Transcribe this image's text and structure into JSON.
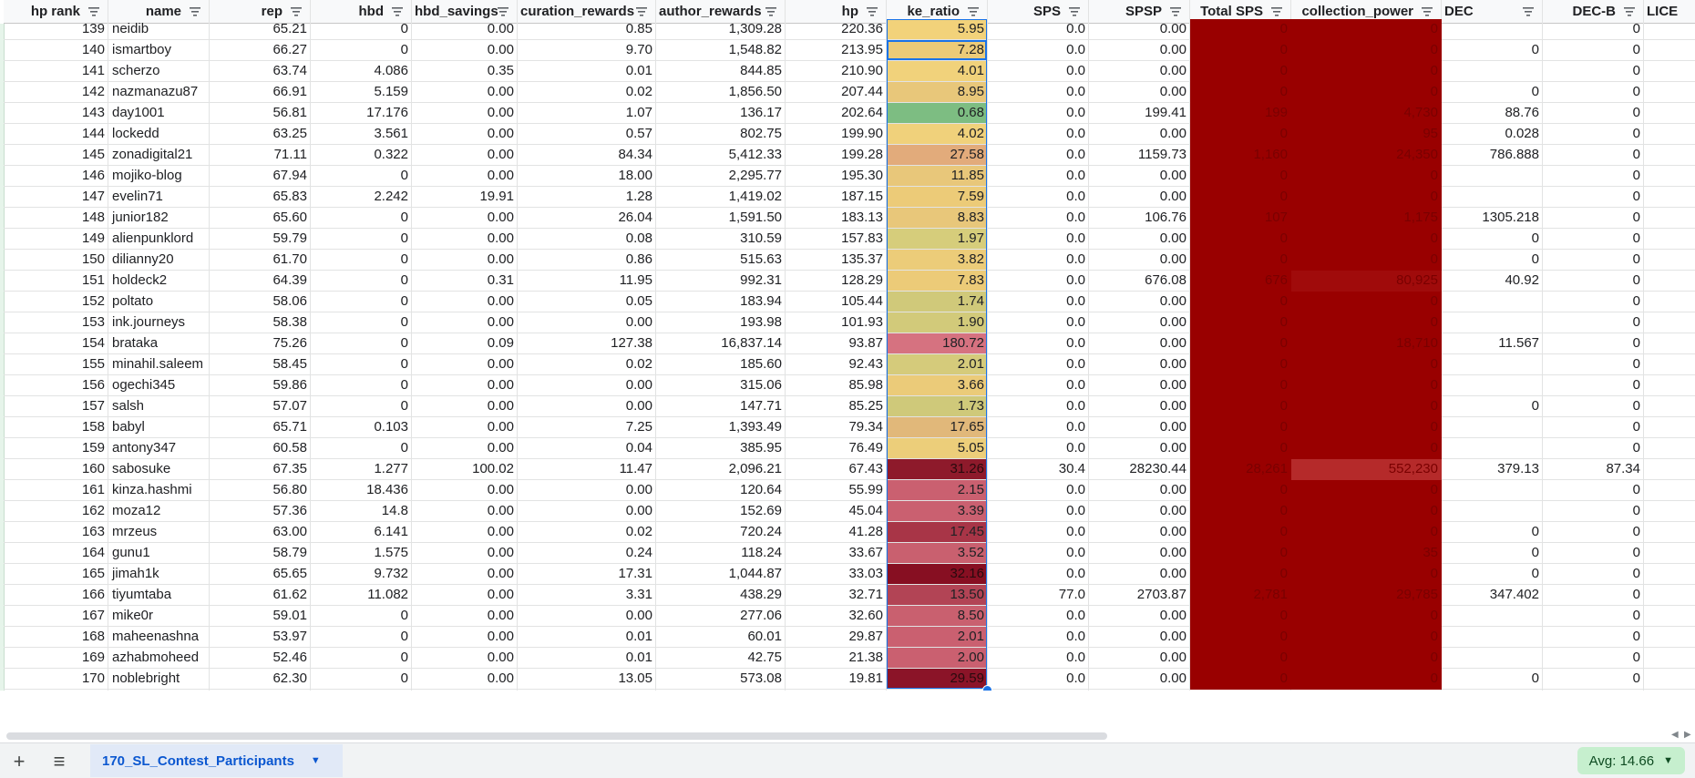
{
  "columns": [
    {
      "key": "hp_rank",
      "label": "hp rank",
      "width": 115,
      "align": "num"
    },
    {
      "key": "name",
      "label": "name",
      "width": 111,
      "align": "txt"
    },
    {
      "key": "rep",
      "label": "rep",
      "width": 111,
      "align": "num"
    },
    {
      "key": "hbd",
      "label": "hbd",
      "width": 111,
      "align": "num"
    },
    {
      "key": "hbd_savings",
      "label": "hbd_savings",
      "width": 116,
      "align": "num"
    },
    {
      "key": "curation_rewards",
      "label": "curation_rewards",
      "width": 152,
      "align": "num"
    },
    {
      "key": "author_rewards",
      "label": "author_rewards",
      "width": 142,
      "align": "num"
    },
    {
      "key": "hp",
      "label": "hp",
      "width": 111,
      "align": "num"
    },
    {
      "key": "ke_ratio",
      "label": "ke_ratio",
      "width": 111,
      "align": "num"
    },
    {
      "key": "sps",
      "label": "SPS",
      "width": 111,
      "align": "num"
    },
    {
      "key": "spsp",
      "label": "SPSP",
      "width": 111,
      "align": "num"
    },
    {
      "key": "total_sps",
      "label": "Total SPS",
      "width": 111,
      "align": "num"
    },
    {
      "key": "collection_power",
      "label": "collection_power",
      "width": 165,
      "align": "num"
    },
    {
      "key": "dec",
      "label": "DEC",
      "width": 111,
      "align": "num",
      "left_header": true
    },
    {
      "key": "dec_b",
      "label": "DEC-B",
      "width": 111,
      "align": "num"
    },
    {
      "key": "lice",
      "label": "LICE",
      "width": 88,
      "align": "num"
    }
  ],
  "rows": [
    [
      "139",
      "neidib",
      "65.21",
      "0",
      "0.00",
      "0.85",
      "1,309.28",
      "220.36",
      "5.95",
      "0.0",
      "0.00",
      "0",
      "0",
      "",
      "0",
      ""
    ],
    [
      "140",
      "ismartboy",
      "66.27",
      "0",
      "0.00",
      "9.70",
      "1,548.82",
      "213.95",
      "7.28",
      "0.0",
      "0.00",
      "0",
      "0",
      "0",
      "0",
      ""
    ],
    [
      "141",
      "scherzo",
      "63.74",
      "4.086",
      "0.35",
      "0.01",
      "844.85",
      "210.90",
      "4.01",
      "0.0",
      "0.00",
      "0",
      "0",
      "",
      "0",
      ""
    ],
    [
      "142",
      "nazmanazu87",
      "66.91",
      "5.159",
      "0.00",
      "0.02",
      "1,856.50",
      "207.44",
      "8.95",
      "0.0",
      "0.00",
      "0",
      "0",
      "0",
      "0",
      ""
    ],
    [
      "143",
      "day1001",
      "56.81",
      "17.176",
      "0.00",
      "1.07",
      "136.17",
      "202.64",
      "0.68",
      "0.0",
      "199.41",
      "199",
      "4,730",
      "88.76",
      "0",
      ""
    ],
    [
      "144",
      "lockedd",
      "63.25",
      "3.561",
      "0.00",
      "0.57",
      "802.75",
      "199.90",
      "4.02",
      "0.0",
      "0.00",
      "0",
      "95",
      "0.028",
      "0",
      ""
    ],
    [
      "145",
      "zonadigital21",
      "71.11",
      "0.322",
      "0.00",
      "84.34",
      "5,412.33",
      "199.28",
      "27.58",
      "0.0",
      "1159.73",
      "1,160",
      "24,350",
      "786.888",
      "0",
      ""
    ],
    [
      "146",
      "mojiko-blog",
      "67.94",
      "0",
      "0.00",
      "18.00",
      "2,295.77",
      "195.30",
      "11.85",
      "0.0",
      "0.00",
      "0",
      "0",
      "",
      "0",
      ""
    ],
    [
      "147",
      "evelin71",
      "65.83",
      "2.242",
      "19.91",
      "1.28",
      "1,419.02",
      "187.15",
      "7.59",
      "0.0",
      "0.00",
      "0",
      "0",
      "",
      "0",
      ""
    ],
    [
      "148",
      "junior182",
      "65.60",
      "0",
      "0.00",
      "26.04",
      "1,591.50",
      "183.13",
      "8.83",
      "0.0",
      "106.76",
      "107",
      "1,175",
      "1305.218",
      "0",
      ""
    ],
    [
      "149",
      "alienpunklord",
      "59.79",
      "0",
      "0.00",
      "0.08",
      "310.59",
      "157.83",
      "1.97",
      "0.0",
      "0.00",
      "0",
      "0",
      "0",
      "0",
      ""
    ],
    [
      "150",
      "dilianny20",
      "61.70",
      "0",
      "0.00",
      "0.86",
      "515.63",
      "135.37",
      "3.82",
      "0.0",
      "0.00",
      "0",
      "0",
      "0",
      "0",
      ""
    ],
    [
      "151",
      "holdeck2",
      "64.39",
      "0",
      "0.31",
      "11.95",
      "992.31",
      "128.29",
      "7.83",
      "0.0",
      "676.08",
      "676",
      "80,925",
      "40.92",
      "0",
      ""
    ],
    [
      "152",
      "poltato",
      "58.06",
      "0",
      "0.00",
      "0.05",
      "183.94",
      "105.44",
      "1.74",
      "0.0",
      "0.00",
      "0",
      "0",
      "",
      "0",
      ""
    ],
    [
      "153",
      "ink.journeys",
      "58.38",
      "0",
      "0.00",
      "0.00",
      "193.98",
      "101.93",
      "1.90",
      "0.0",
      "0.00",
      "0",
      "0",
      "",
      "0",
      ""
    ],
    [
      "154",
      "brataka",
      "75.26",
      "0",
      "0.09",
      "127.38",
      "16,837.14",
      "93.87",
      "180.72",
      "0.0",
      "0.00",
      "0",
      "18,710",
      "11.567",
      "0",
      ""
    ],
    [
      "155",
      "minahil.saleem",
      "58.45",
      "0",
      "0.00",
      "0.02",
      "185.60",
      "92.43",
      "2.01",
      "0.0",
      "0.00",
      "0",
      "0",
      "",
      "0",
      ""
    ],
    [
      "156",
      "ogechi345",
      "59.86",
      "0",
      "0.00",
      "0.00",
      "315.06",
      "85.98",
      "3.66",
      "0.0",
      "0.00",
      "0",
      "0",
      "",
      "0",
      ""
    ],
    [
      "157",
      "salsh",
      "57.07",
      "0",
      "0.00",
      "0.00",
      "147.71",
      "85.25",
      "1.73",
      "0.0",
      "0.00",
      "0",
      "0",
      "0",
      "0",
      ""
    ],
    [
      "158",
      "babyl",
      "65.71",
      "0.103",
      "0.00",
      "7.25",
      "1,393.49",
      "79.34",
      "17.65",
      "0.0",
      "0.00",
      "0",
      "0",
      "",
      "0",
      ""
    ],
    [
      "159",
      "antony347",
      "60.58",
      "0",
      "0.00",
      "0.04",
      "385.95",
      "76.49",
      "5.05",
      "0.0",
      "0.00",
      "0",
      "0",
      "",
      "0",
      ""
    ],
    [
      "160",
      "sabosuke",
      "67.35",
      "1.277",
      "100.02",
      "11.47",
      "2,096.21",
      "67.43",
      "31.26",
      "30.4",
      "28230.44",
      "28,261",
      "552,230",
      "379.13",
      "87.34",
      ""
    ],
    [
      "161",
      "kinza.hashmi",
      "56.80",
      "18.436",
      "0.00",
      "0.00",
      "120.64",
      "55.99",
      "2.15",
      "0.0",
      "0.00",
      "0",
      "0",
      "",
      "0",
      ""
    ],
    [
      "162",
      "moza12",
      "57.36",
      "14.8",
      "0.00",
      "0.00",
      "152.69",
      "45.04",
      "3.39",
      "0.0",
      "0.00",
      "0",
      "0",
      "",
      "0",
      ""
    ],
    [
      "163",
      "mrzeus",
      "63.00",
      "6.141",
      "0.00",
      "0.02",
      "720.24",
      "41.28",
      "17.45",
      "0.0",
      "0.00",
      "0",
      "0",
      "0",
      "0",
      ""
    ],
    [
      "164",
      "gunu1",
      "58.79",
      "1.575",
      "0.00",
      "0.24",
      "118.24",
      "33.67",
      "3.52",
      "0.0",
      "0.00",
      "0",
      "35",
      "0",
      "0",
      ""
    ],
    [
      "165",
      "jimah1k",
      "65.65",
      "9.732",
      "0.00",
      "17.31",
      "1,044.87",
      "33.03",
      "32.16",
      "0.0",
      "0.00",
      "0",
      "0",
      "0",
      "0",
      ""
    ],
    [
      "166",
      "tiyumtaba",
      "61.62",
      "11.082",
      "0.00",
      "3.31",
      "438.29",
      "32.71",
      "13.50",
      "77.0",
      "2703.87",
      "2,781",
      "29,785",
      "347.402",
      "0",
      ""
    ],
    [
      "167",
      "mike0r",
      "59.01",
      "0",
      "0.00",
      "0.00",
      "277.06",
      "32.60",
      "8.50",
      "0.0",
      "0.00",
      "0",
      "0",
      "",
      "0",
      ""
    ],
    [
      "168",
      "maheenashna",
      "53.97",
      "0",
      "0.00",
      "0.01",
      "60.01",
      "29.87",
      "2.01",
      "0.0",
      "0.00",
      "0",
      "0",
      "",
      "0",
      ""
    ],
    [
      "169",
      "azhabmoheed",
      "52.46",
      "0",
      "0.00",
      "0.01",
      "42.75",
      "21.38",
      "2.00",
      "0.0",
      "0.00",
      "0",
      "0",
      "",
      "0",
      ""
    ],
    [
      "170",
      "noblebright",
      "62.30",
      "0",
      "0.00",
      "13.05",
      "573.08",
      "19.81",
      "29.59",
      "0.0",
      "0.00",
      "0",
      "0",
      "0",
      "0",
      ""
    ]
  ],
  "ke_ratio_fills": [
    "#f2d27a",
    "#eccb78",
    "#f1d27b",
    "#e8c77a",
    "#7dbd82",
    "#f0d17b",
    "#e2ab7b",
    "#e8c77a",
    "#eccb78",
    "#e8c77a",
    "#d6cd7b",
    "#eccc79",
    "#eccb78",
    "#d0c97a",
    "#d2ca7a",
    "#d67280",
    "#d5cb7b",
    "#ebcb79",
    "#cfc97a",
    "#e1b87a",
    "#ecce7a",
    "#8e1a2b",
    "#ca6070",
    "#ca6070",
    "#a83547",
    "#c9606f",
    "#870f22",
    "#b24455",
    "#c9606f",
    "#ca6070",
    "#ca6070",
    "#8b1428"
  ],
  "red_fills": {
    "total_sps": [
      "#990000",
      "#990000",
      "#990000",
      "#990000",
      "#990000",
      "#990000",
      "#990000",
      "#990000",
      "#990000",
      "#990000",
      "#990000",
      "#990000",
      "#990000",
      "#990000",
      "#990000",
      "#990000",
      "#990000",
      "#990000",
      "#990000",
      "#990000",
      "#990000",
      "#990000",
      "#990000",
      "#990000",
      "#990000",
      "#990000",
      "#990000",
      "#990000",
      "#990000",
      "#990000",
      "#990000",
      "#990000"
    ],
    "collection_power": [
      "#990000",
      "#990000",
      "#990000",
      "#990000",
      "#990000",
      "#990000",
      "#990000",
      "#990000",
      "#990000",
      "#990000",
      "#990000",
      "#990000",
      "#a00b0b",
      "#990000",
      "#990000",
      "#990000",
      "#990000",
      "#990000",
      "#990000",
      "#990000",
      "#990000",
      "#b52a2a",
      "#990000",
      "#990000",
      "#990000",
      "#990000",
      "#990000",
      "#990000",
      "#990000",
      "#990000",
      "#990000",
      "#990000"
    ]
  },
  "selected_cell": {
    "row_index": 1,
    "col_key": "ke_ratio"
  },
  "selection_range": {
    "col_key": "ke_ratio",
    "from_row": 1,
    "to_row": 31
  },
  "bottom": {
    "add_sheet_icon": "+",
    "sheet_list_icon": "≡",
    "sheet_tab_label": "170_SL_Contest_Participants",
    "avg_label": "Avg: 14.66"
  },
  "colors": {
    "header_bg": "#f8f9fa",
    "red_cell": "#990000",
    "red_text": "#7a0000",
    "selection": "#1a73e8"
  }
}
